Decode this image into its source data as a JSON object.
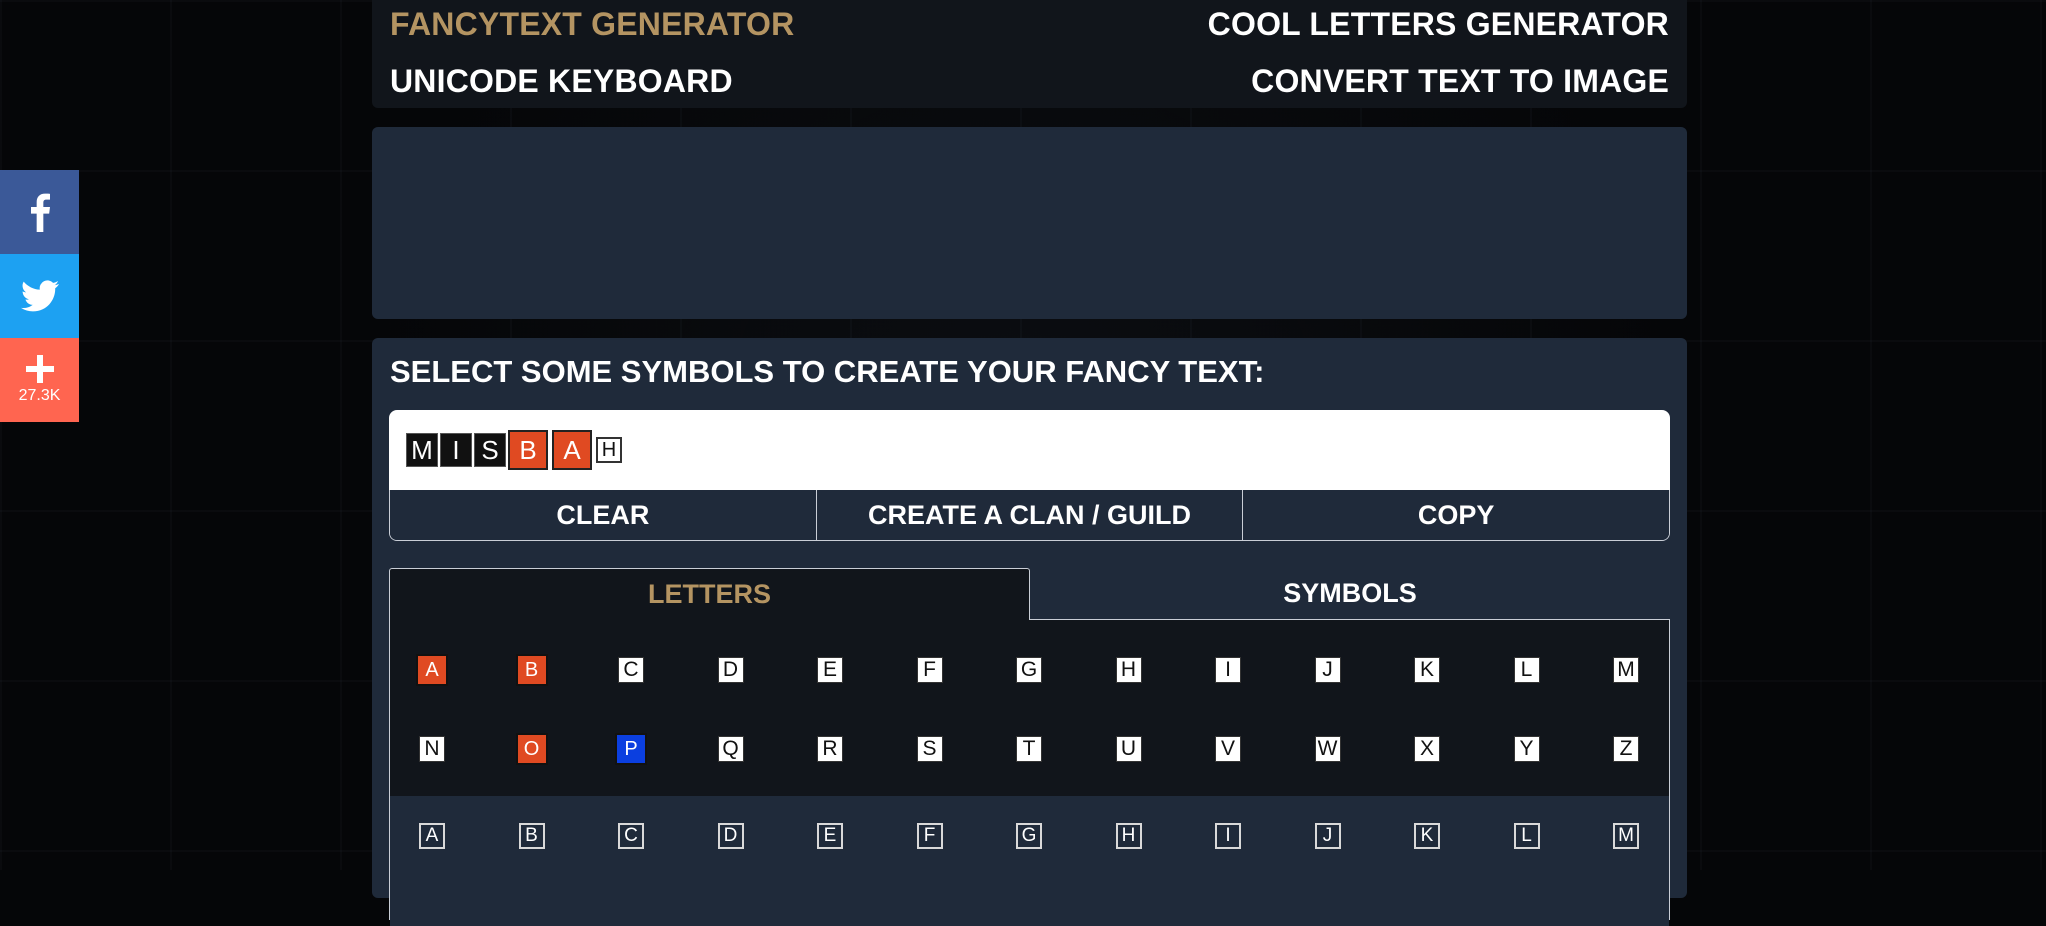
{
  "nav": {
    "links": [
      {
        "label": "FANCYTEXT GENERATOR",
        "active": true
      },
      {
        "label": "COOL LETTERS GENERATOR",
        "active": false
      },
      {
        "label": "UNICODE KEYBOARD",
        "active": false
      },
      {
        "label": "CONVERT TEXT TO IMAGE",
        "active": false
      }
    ]
  },
  "social": {
    "items": [
      {
        "icon": "facebook-icon"
      },
      {
        "icon": "twitter-icon"
      },
      {
        "icon": "plus-icon",
        "count": "27.3K"
      }
    ]
  },
  "main": {
    "title": "SELECT SOME SYMBOLS TO CREATE YOUR FANCY TEXT:",
    "preview": [
      {
        "char": "M",
        "style": "black"
      },
      {
        "char": "I",
        "style": "black"
      },
      {
        "char": "S",
        "style": "black"
      },
      {
        "char": "B",
        "style": "red"
      },
      {
        "char": "A",
        "style": "red"
      },
      {
        "char": "H",
        "style": "outline"
      }
    ],
    "actions": {
      "clear": "CLEAR",
      "clan": "CREATE A CLAN / GUILD",
      "copy": "COPY"
    },
    "tabs": {
      "letters": "LETTERS",
      "symbols": "SYMBOLS"
    },
    "letters_set1": [
      {
        "char": "A",
        "style": "red"
      },
      {
        "char": "B",
        "style": "red"
      },
      {
        "char": "C",
        "style": "white"
      },
      {
        "char": "D",
        "style": "white"
      },
      {
        "char": "E",
        "style": "white"
      },
      {
        "char": "F",
        "style": "white"
      },
      {
        "char": "G",
        "style": "white"
      },
      {
        "char": "H",
        "style": "white"
      },
      {
        "char": "I",
        "style": "white"
      },
      {
        "char": "J",
        "style": "white"
      },
      {
        "char": "K",
        "style": "white"
      },
      {
        "char": "L",
        "style": "white"
      },
      {
        "char": "M",
        "style": "white"
      },
      {
        "char": "N",
        "style": "white"
      },
      {
        "char": "O",
        "style": "red"
      },
      {
        "char": "P",
        "style": "blue"
      },
      {
        "char": "Q",
        "style": "white"
      },
      {
        "char": "R",
        "style": "white"
      },
      {
        "char": "S",
        "style": "white"
      },
      {
        "char": "T",
        "style": "white"
      },
      {
        "char": "U",
        "style": "white"
      },
      {
        "char": "V",
        "style": "white"
      },
      {
        "char": "W",
        "style": "white"
      },
      {
        "char": "X",
        "style": "white"
      },
      {
        "char": "Y",
        "style": "white"
      },
      {
        "char": "Z",
        "style": "white"
      }
    ],
    "letters_set2": [
      {
        "char": "A",
        "style": "outline"
      },
      {
        "char": "B",
        "style": "outline"
      },
      {
        "char": "C",
        "style": "outline"
      },
      {
        "char": "D",
        "style": "outline"
      },
      {
        "char": "E",
        "style": "outline"
      },
      {
        "char": "F",
        "style": "outline"
      },
      {
        "char": "G",
        "style": "outline"
      },
      {
        "char": "H",
        "style": "outline"
      },
      {
        "char": "I",
        "style": "outline"
      },
      {
        "char": "J",
        "style": "outline"
      },
      {
        "char": "K",
        "style": "outline"
      },
      {
        "char": "L",
        "style": "outline"
      },
      {
        "char": "M",
        "style": "outline"
      }
    ]
  },
  "colors": {
    "accent": "#b49462",
    "panel": "#1f2a3a",
    "panel_dark": "#11151b",
    "red_tile": "#e04a22",
    "blue_tile": "#0b3fe0"
  }
}
